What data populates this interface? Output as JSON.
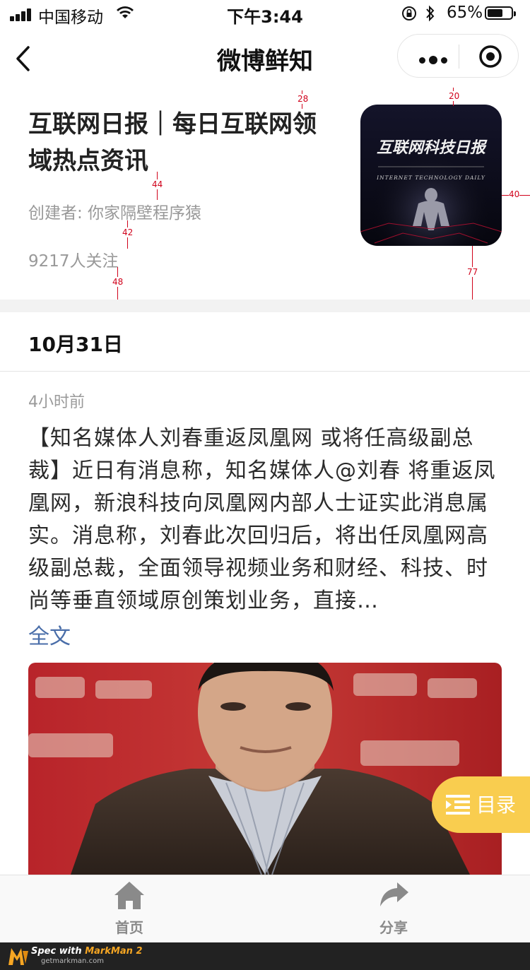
{
  "status": {
    "carrier": "中国移动",
    "time": "下午3:44",
    "battery_pct": "65%",
    "battery_level": 0.65
  },
  "nav": {
    "title": "微博鲜知"
  },
  "header": {
    "title": "互联网日报｜每日互联网领域热点资讯",
    "creator": "创建者: 你家隔壁程序猿",
    "followers": "9217人关注",
    "cover_title": "互联网科技日报",
    "cover_subtitle": "INTERNET TECHNOLOGY DAILY"
  },
  "measures": {
    "m1": "28",
    "m2": "20",
    "m3": "40",
    "m4": "44",
    "m5": "42",
    "m6": "48",
    "m7": "77"
  },
  "feed": {
    "date": "10月31日",
    "time_ago": "4小时前",
    "text": "【知名媒体人刘春重返凤凰网 或将任高级副总裁】近日有消息称，知名媒体人@刘春 将重返凤凰网，新浪科技向凤凰网内部人士证实此消息属实。消息称，刘春此次回归后，将出任凤凰网高级副总裁，全面领导视频业务和财经、科技、时尚等垂直领域原创策划业务，直接…",
    "full_link": "全文"
  },
  "toc": {
    "label": "目录"
  },
  "tabbar": {
    "home": "首页",
    "share": "分享"
  },
  "footer": {
    "spec": "Spec with",
    "brand": "MarkMan 2",
    "site": "getmarkman.com"
  },
  "colors": {
    "toc": "#f9cd4f",
    "link": "#4a6ea9",
    "measure": "#d0021b"
  }
}
